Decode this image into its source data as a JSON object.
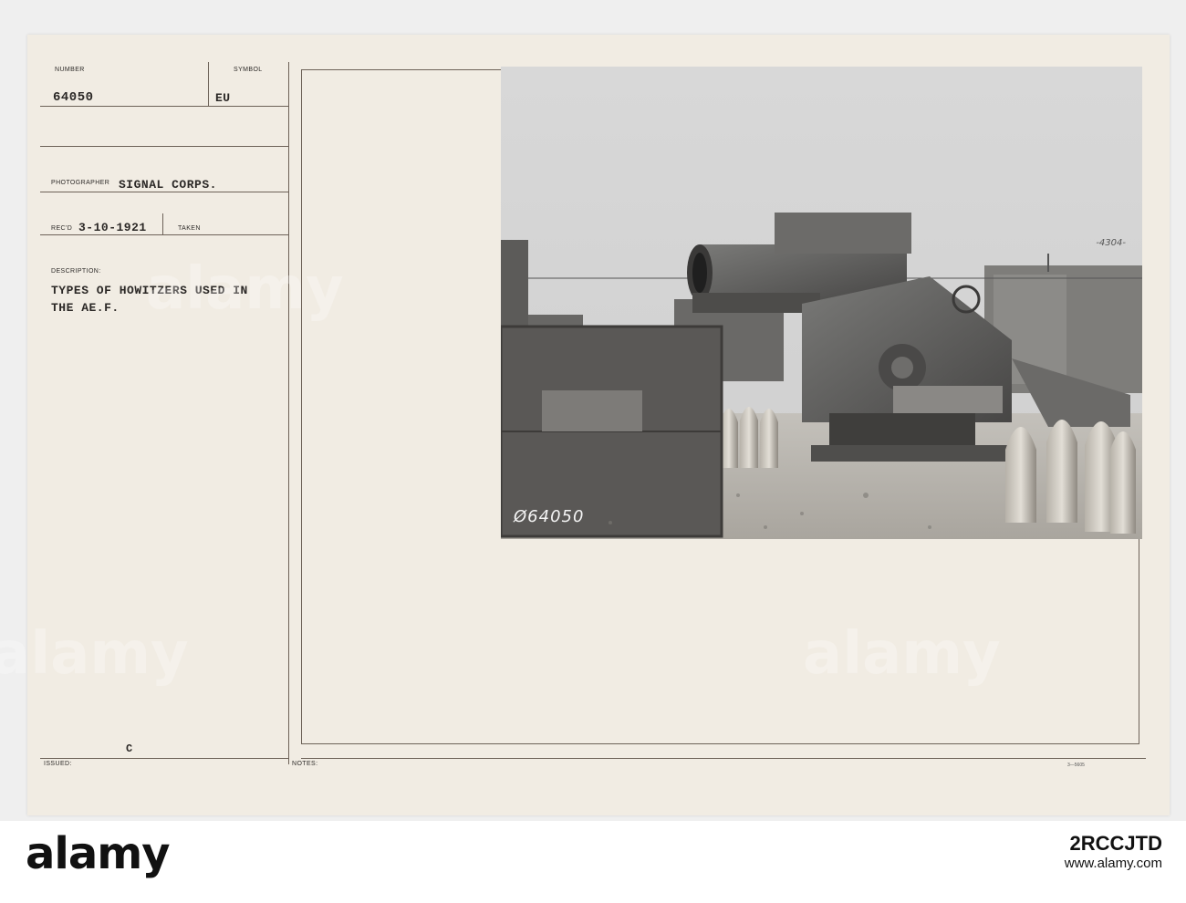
{
  "card": {
    "labels": {
      "number": "NUMBER",
      "symbol": "SYMBOL",
      "photographer": "PHOTOGRAPHER",
      "recd": "REC'D",
      "taken": "TAKEN",
      "description": "DESCRIPTION:",
      "issued": "ISSUED:",
      "notes": "NOTES:"
    },
    "values": {
      "number": "64050",
      "symbol": "EU",
      "photographer": "SIGNAL CORPS.",
      "recd": "3-10-1921",
      "description_line1": "TYPES OF HOWITZERS USED IN",
      "description_line2": "THE AE.F.",
      "issued_mark": "C"
    },
    "form_code": "3—5605"
  },
  "photo": {
    "negative_number": "Ø64050",
    "corner_tag": "-4304-"
  },
  "watermark": {
    "logo": "alamy",
    "image_id": "2RCCJTD",
    "site": "www.alamy.com"
  }
}
